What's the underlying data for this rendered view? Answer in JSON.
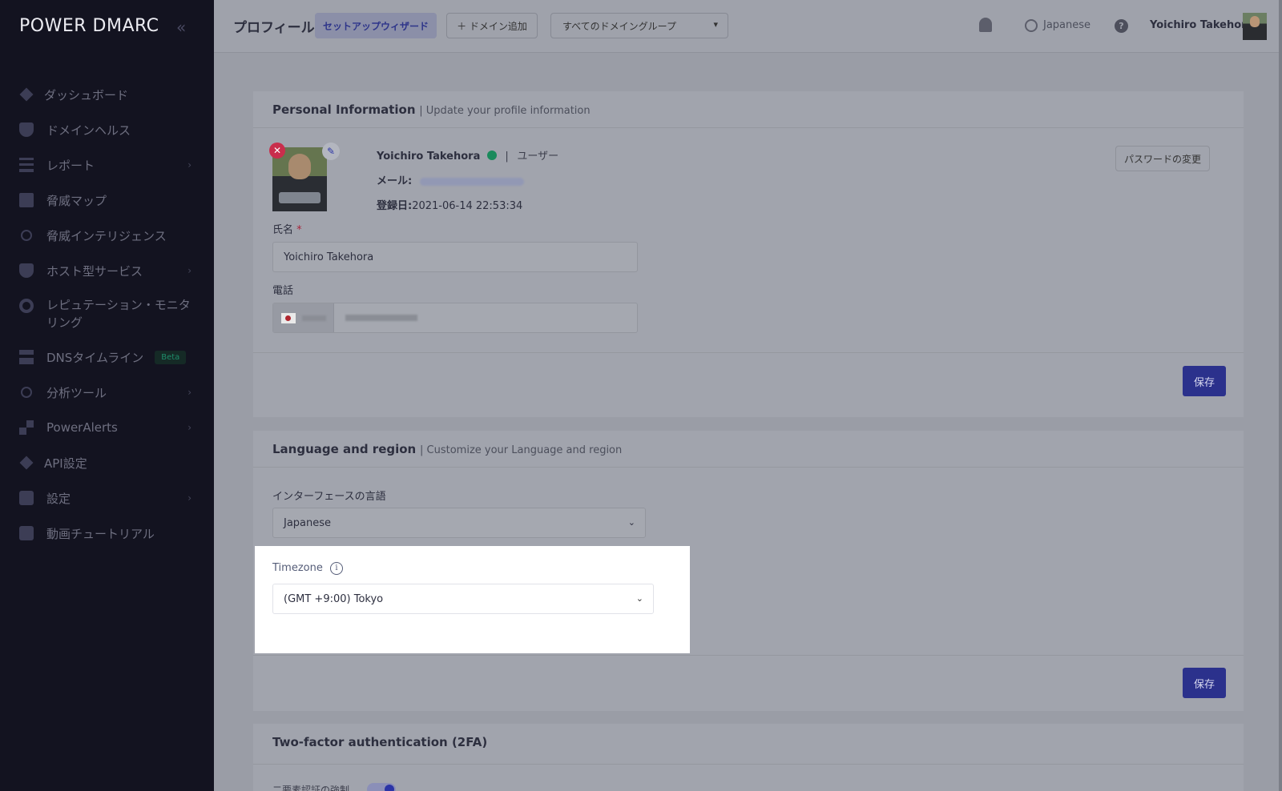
{
  "app": {
    "logo": "POWER DMARC"
  },
  "sidebar": {
    "items": [
      {
        "label": "ダッシュボード",
        "icon": "diamond-icon"
      },
      {
        "label": "ドメインヘルス",
        "icon": "shield-icon"
      },
      {
        "label": "レポート",
        "icon": "report-icon",
        "chevron": "›"
      },
      {
        "label": "脅威マップ",
        "icon": "map-icon"
      },
      {
        "label": "脅威インテリジェンス",
        "icon": "circle-icon"
      },
      {
        "label": "ホスト型サービス",
        "icon": "host-icon",
        "chevron": "›"
      },
      {
        "label": "レピュテーション・モニタリング",
        "icon": "gear-icon"
      },
      {
        "label": "DNSタイムライン",
        "icon": "dns-icon",
        "badge": "Beta"
      },
      {
        "label": "分析ツール",
        "icon": "circle-icon",
        "chevron": "›"
      },
      {
        "label": "PowerAlerts",
        "icon": "grid-icon",
        "chevron": "›"
      },
      {
        "label": "API設定",
        "icon": "diamond-icon"
      },
      {
        "label": "設定",
        "icon": "settings-icon",
        "chevron": "›"
      },
      {
        "label": "動画チュートリアル",
        "icon": "video-icon"
      }
    ]
  },
  "topbar": {
    "title": "プロフィール",
    "wizard": "セットアップウィザード",
    "add_domain": "＋ ドメイン追加",
    "domain_group": "すべてのドメイングループ",
    "language": "Japanese",
    "help": "?",
    "user_name": "Yoichiro Takehora"
  },
  "personal": {
    "title": "Personal Information",
    "subtitle": "| Update your profile information",
    "name": "Yoichiro Takehora",
    "role_sep": "|",
    "role": "ユーザー",
    "email_label": "メール:",
    "registered_label": "登録日:",
    "registered_value": "2021-06-14 22:53:34",
    "change_password": "パスワードの変更",
    "full_name_label": "氏名",
    "full_name_required": "*",
    "full_name_value": "Yoichiro Takehora",
    "phone_label": "電話",
    "save": "保存"
  },
  "language_region": {
    "title": "Language and region",
    "subtitle": "| Customize your Language and region",
    "interface_label": "インターフェースの言語",
    "interface_value": "Japanese",
    "timezone_label": "Timezone",
    "timezone_value": "(GMT +9:00) Tokyo",
    "save": "保存"
  },
  "twofa": {
    "title": "Two-factor authentication (2FA)",
    "enforce_label": "二要素認証の強制",
    "enforced": true
  }
}
